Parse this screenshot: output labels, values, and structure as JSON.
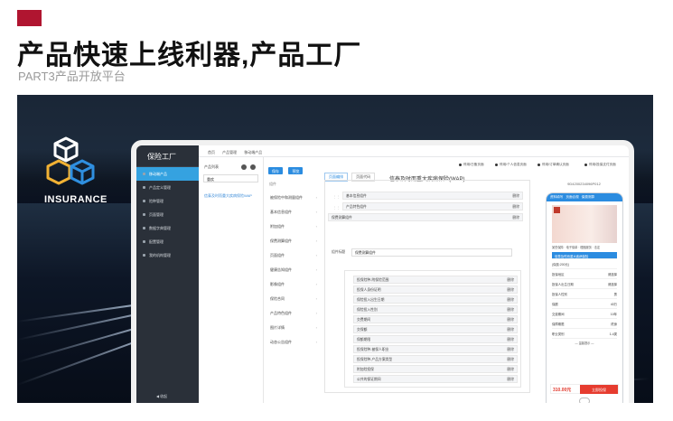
{
  "slide": {
    "title": "产品快速上线利器,产品工厂",
    "subtitle": "PART3产品开放平台",
    "brand": "INSURANCE"
  },
  "colors": {
    "accent": "#b01530",
    "sidebar_active": "#35a2e0",
    "primary": "#2b8ce0"
  },
  "app": {
    "logo": "保险工厂",
    "nav": [
      "首页",
      "产品管理",
      "移动端产品"
    ],
    "sidebar": [
      {
        "label": "移动端产品",
        "active": true
      },
      {
        "label": "产品定义管理",
        "active": false
      },
      {
        "label": "险种管理",
        "active": false
      },
      {
        "label": "页面管理",
        "active": false
      },
      {
        "label": "数据字典管理",
        "active": false
      },
      {
        "label": "配置管理",
        "active": false
      },
      {
        "label": "我的机构管理",
        "active": false
      }
    ],
    "collapse": "收起",
    "left_panel": {
      "title": "产品列表",
      "search_value": "重疾",
      "product_link": "信泰及时而重大疾病保险WAP"
    },
    "toolbar": {
      "save": "保存",
      "preview": "预览"
    },
    "ops": [
      "停用/日备页面",
      "停用/个人信息页面",
      "停用/订单确认页面",
      "停用/投保支付页面"
    ],
    "components": {
      "label": "组件",
      "items": [
        "被保险中和测量组件",
        "基本信息组件",
        "附加组件",
        "保费测算组件",
        "页面组件",
        "健康告知组件",
        "影像组件",
        "保险合同",
        "产品特色组件",
        "图片详情",
        "动态公告组件"
      ]
    },
    "canvas": {
      "tabs": [
        "页面编排",
        "页面代码"
      ],
      "title": "信泰及时而重大疾病保险(WAP)",
      "blocks": [
        "基本信息组件",
        "产品特色组件",
        "保费测算组件"
      ],
      "delete": "删除",
      "input_label": "组件标题",
      "input_value": "保费测算组件",
      "nested": [
        "投保险种-附保险范围",
        "投保人身份证明",
        "保险投入出生日期",
        "保险投入性别",
        "交费期间",
        "交保额",
        "保额期限",
        "投保险种-被保人职业",
        "投保险种-产品方案类型",
        "附加险投保",
        "公共的保证期间"
      ]
    },
    "preview": {
      "header": "9D4200234096P012",
      "tabs": [
        "资料填写",
        "页面合规",
        "保费测算"
      ],
      "mini": [
        "某些保障",
        "电子保单",
        "理赔服务",
        "法定"
      ],
      "product": "信泰及时而重大疾病保险",
      "plan": "(保费:200元)",
      "rows": [
        {
          "k": "投保地区",
          "v": "请选择"
        },
        {
          "k": "投保人出生日期",
          "v": "请选择"
        },
        {
          "k": "投保人性别",
          "v": "男"
        },
        {
          "k": "保额",
          "v": "40万"
        },
        {
          "k": "交费期间",
          "v": "10年"
        },
        {
          "k": "保障期限",
          "v": "终身"
        },
        {
          "k": "职业类别",
          "v": "1-4类"
        }
      ],
      "divider": "— 温馨提示 —",
      "price": "310.00元",
      "buy": "立即投保"
    }
  }
}
